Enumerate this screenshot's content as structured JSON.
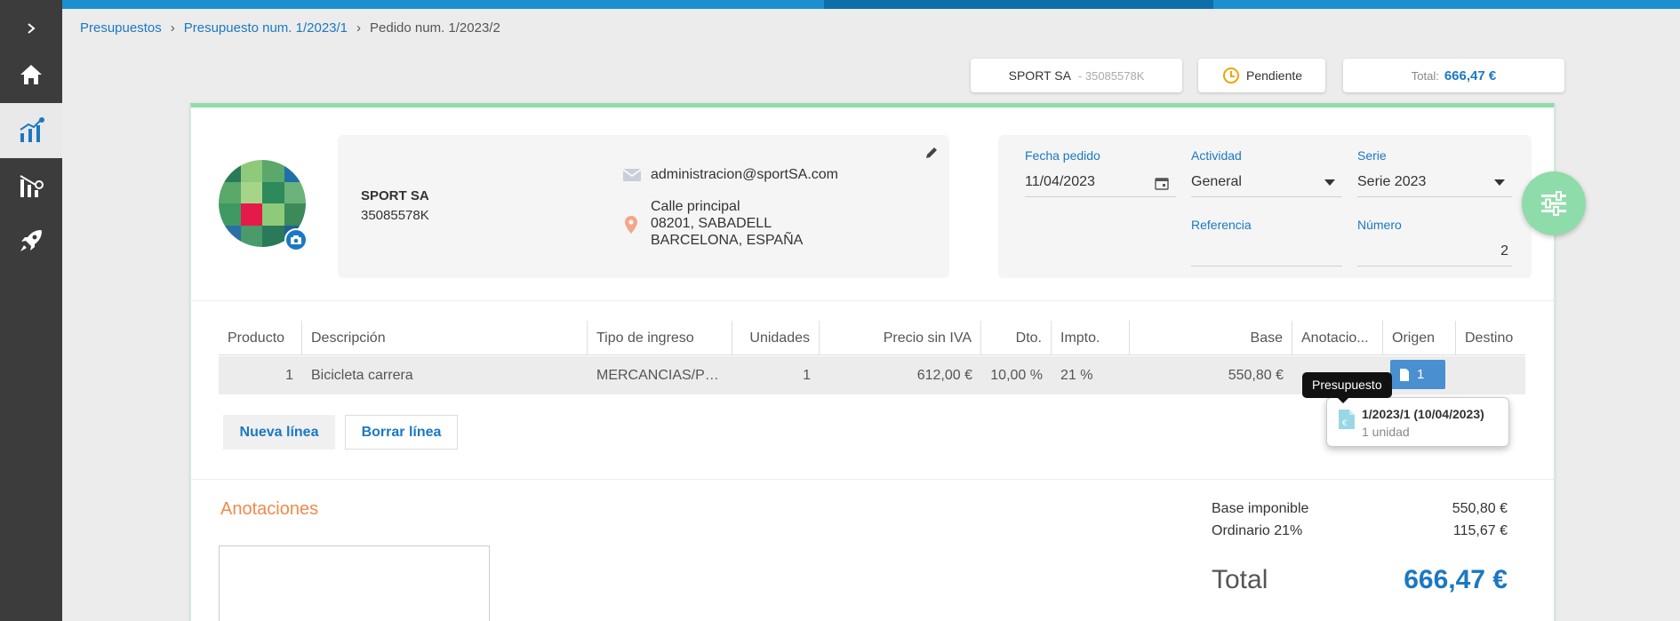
{
  "breadcrumb": {
    "items": [
      "Presupuestos",
      "Presupuesto num. 1/2023/1"
    ],
    "current": "Pedido num. 1/2023/2"
  },
  "header": {
    "client_name": "SPORT SA",
    "client_nif": "- 35085578K",
    "status": "Pendiente",
    "total_label": "Total:",
    "total_value": "666,47 €"
  },
  "client": {
    "name": "SPORT SA",
    "nif": "35085578K",
    "email": "administracion@sportSA.com",
    "address_line1": "Calle principal",
    "address_line2": "08201, SABADELL",
    "address_line3": "BARCELONA, ESPAÑA"
  },
  "fields": {
    "fecha_label": "Fecha pedido",
    "fecha_value": "11/04/2023",
    "actividad_label": "Actividad",
    "actividad_value": "General",
    "serie_label": "Serie",
    "serie_value": "Serie 2023",
    "referencia_label": "Referencia",
    "referencia_value": "",
    "numero_label": "Número",
    "numero_value": "2"
  },
  "table": {
    "columns": [
      "Producto",
      "Descripción",
      "Tipo de ingreso",
      "Unidades",
      "Precio sin IVA",
      "Dto.",
      "Impto.",
      "Base",
      "Anotacio...",
      "Origen",
      "Destino"
    ],
    "rows": [
      {
        "producto": "1",
        "descripcion": "Bicicleta carrera",
        "tipo": "MERCANCIAS/PR...",
        "unidades": "1",
        "precio": "612,00 €",
        "dto": "10,00 %",
        "impto": "21 %",
        "base": "550,80 €",
        "origen": "1"
      }
    ]
  },
  "tooltip": {
    "label": "Presupuesto",
    "doc_title": "1/2023/1 (10/04/2023)",
    "doc_sub": "1 unidad"
  },
  "actions": {
    "new_line": "Nueva línea",
    "delete_line": "Borrar línea"
  },
  "annotations": {
    "title": "Anotaciones"
  },
  "totals": {
    "base_label": "Base imponible",
    "base_value": "550,80 €",
    "tax_label": "Ordinario 21%",
    "tax_value": "115,67 €",
    "total_label": "Total",
    "total_value": "666,47 €"
  },
  "colors": {
    "accent": "#1b78c2",
    "green": "#8edcaa",
    "orange": "#f08a4b",
    "sidebar": "#3c3c3c"
  },
  "icons": [
    "chevron-right-icon",
    "home-icon",
    "chart-icon",
    "analytics-icon",
    "rocket-icon",
    "camera-icon",
    "mail-icon",
    "location-pin-icon",
    "edit-icon",
    "calendar-icon",
    "filters-icon",
    "document-icon",
    "clock-icon"
  ]
}
